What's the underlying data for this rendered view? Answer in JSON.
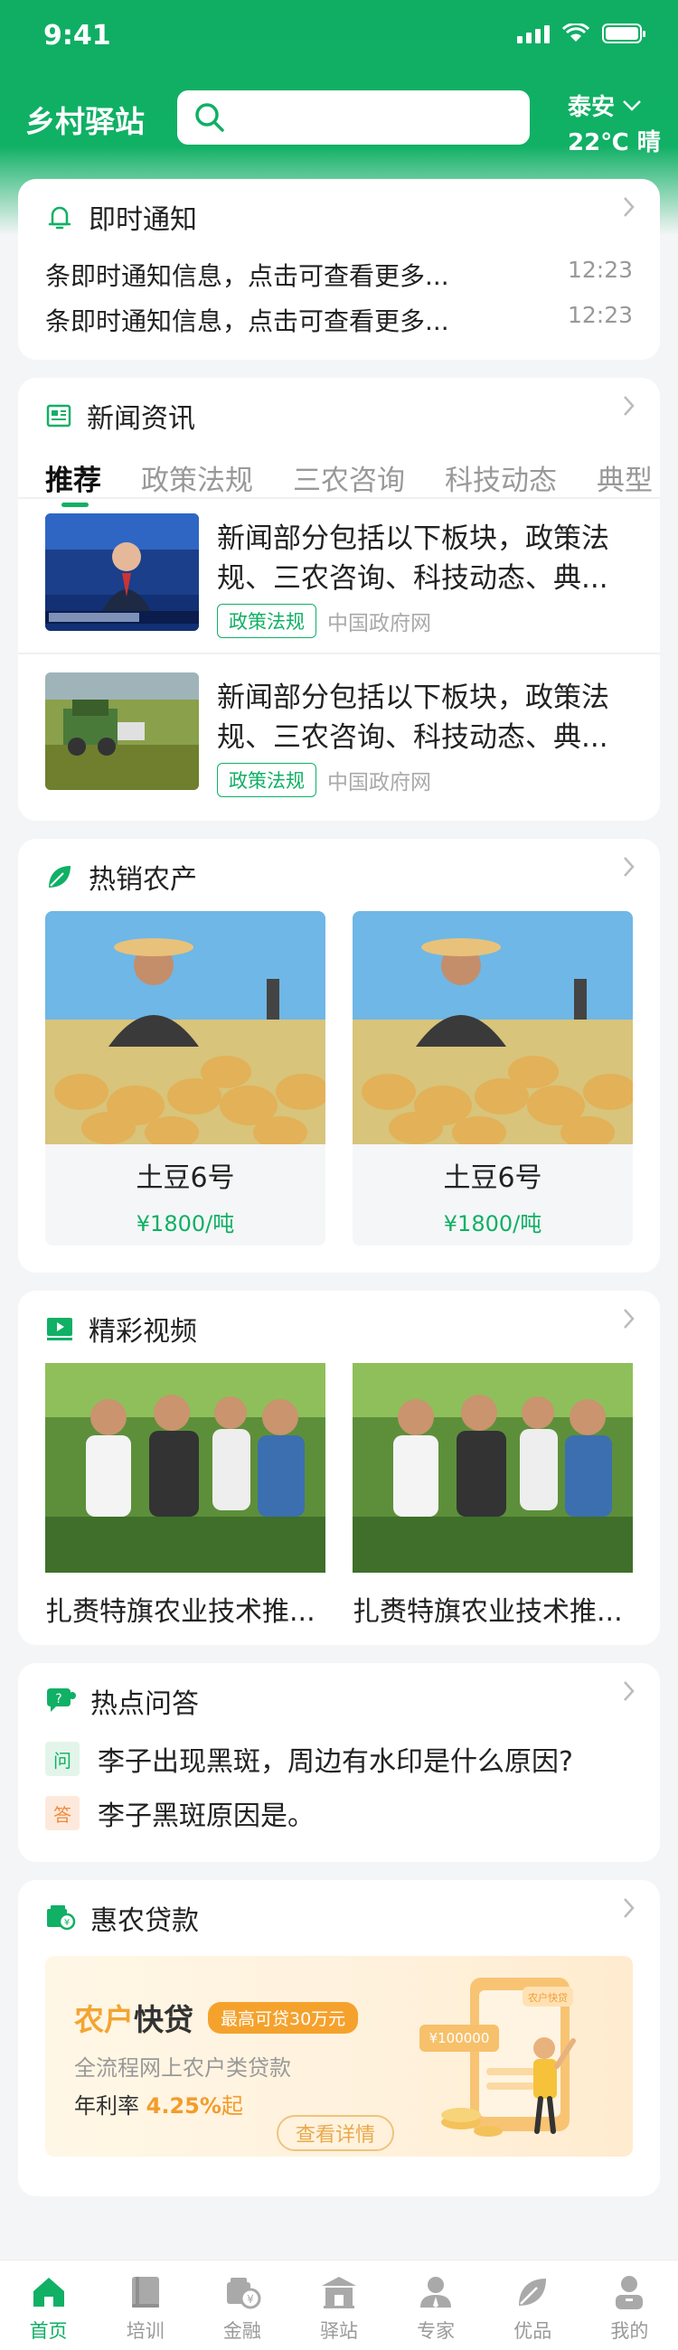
{
  "status": {
    "time": "9:41"
  },
  "header": {
    "title": "乡村驿站",
    "search": {
      "placeholder": ""
    },
    "weather": {
      "city": "泰安",
      "temp": "22℃ 晴"
    }
  },
  "notice": {
    "title": "即时通知",
    "items": [
      {
        "text": "条即时通知信息，点击可查看更多...",
        "time": "12:23"
      },
      {
        "text": "条即时通知信息，点击可查看更多...",
        "time": "12:23"
      }
    ]
  },
  "news": {
    "title": "新闻资讯",
    "tabs": [
      "推荐",
      "政策法规",
      "三农咨询",
      "科技动态",
      "典型"
    ],
    "items": [
      {
        "text": "新闻部分包括以下板块，政策法规、三农咨询、科技动态、典...",
        "tag": "政策法规",
        "source": "中国政府网"
      },
      {
        "text": "新闻部分包括以下板块，政策法规、三农咨询、科技动态、典...",
        "tag": "政策法规",
        "source": "中国政府网"
      }
    ]
  },
  "products": {
    "title": "热销农产",
    "items": [
      {
        "name": "土豆6号",
        "price": "¥1800/吨"
      },
      {
        "name": "土豆6号",
        "price": "¥1800/吨"
      }
    ]
  },
  "videos": {
    "title": "精彩视频",
    "items": [
      {
        "title": "扎赉特旗农业技术推..."
      },
      {
        "title": "扎赉特旗农业技术推..."
      }
    ]
  },
  "qa": {
    "title": "热点问答",
    "question_badge": "问",
    "answer_badge": "答",
    "question": "李子出现黑斑，周边有水印是什么原因?",
    "answer": "李子黑斑原因是。"
  },
  "loan": {
    "title": "惠农贷款",
    "banner": {
      "title_a": "农户",
      "title_b": "快贷",
      "badge": "最高可贷30万元",
      "subtitle": "全流程网上农户类贷款",
      "rate_label": "年利率",
      "rate_value": "4.25%",
      "rate_suffix": "起",
      "button": "查看详情",
      "amount": "¥100000",
      "phone_label": "农户快贷"
    }
  },
  "tabbar": [
    {
      "label": "首页",
      "icon": "home-icon"
    },
    {
      "label": "培训",
      "icon": "book-icon"
    },
    {
      "label": "金融",
      "icon": "finance-icon"
    },
    {
      "label": "驿站",
      "icon": "station-icon"
    },
    {
      "label": "专家",
      "icon": "expert-icon"
    },
    {
      "label": "优品",
      "icon": "leaf-icon"
    },
    {
      "label": "我的",
      "icon": "user-icon"
    }
  ],
  "colors": {
    "brand": "#10b065",
    "price": "#10b065",
    "loan_accent": "#f5a22d",
    "answer_badge": "#f08a3c"
  }
}
